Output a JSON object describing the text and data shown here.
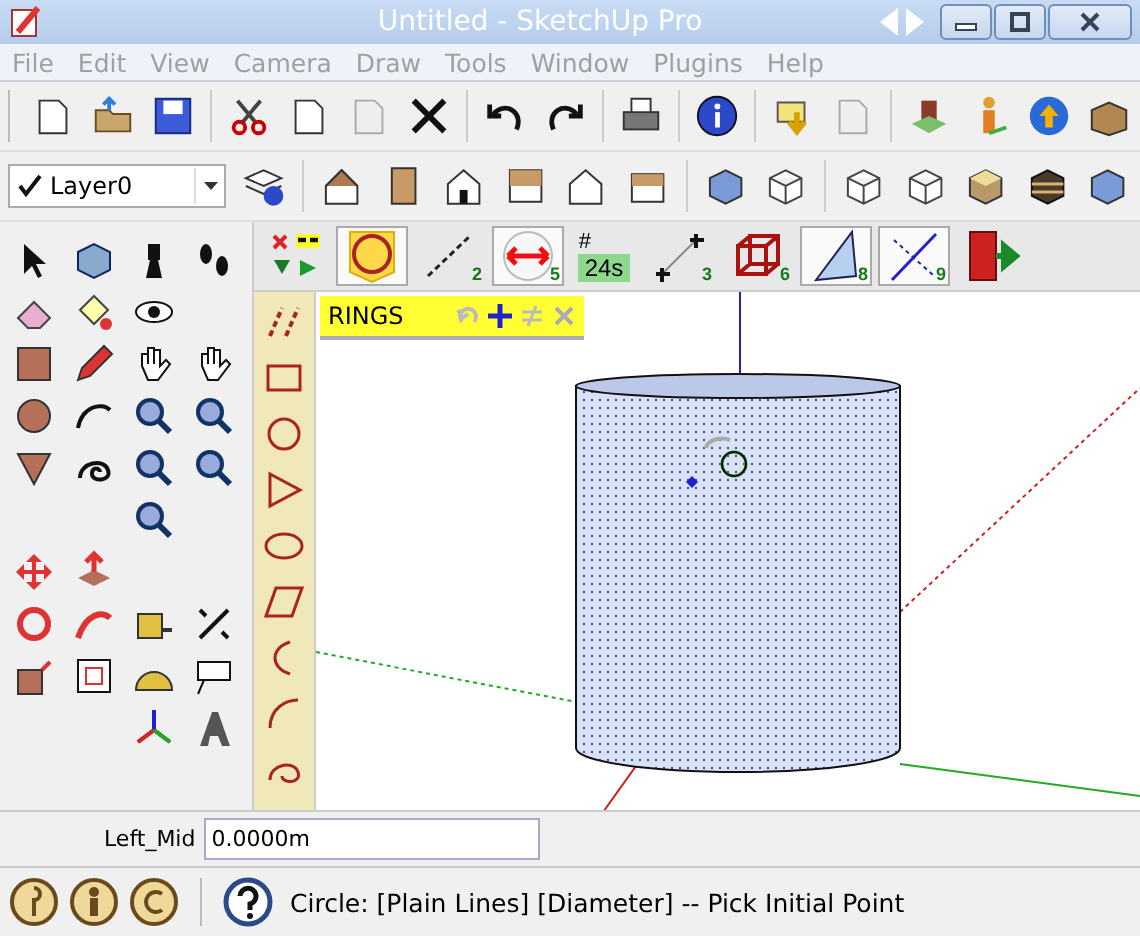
{
  "window": {
    "title": "Untitled - SketchUp Pro",
    "active": false
  },
  "menu": [
    {
      "label": "File"
    },
    {
      "label": "Edit"
    },
    {
      "label": "View"
    },
    {
      "label": "Camera"
    },
    {
      "label": "Draw"
    },
    {
      "label": "Tools"
    },
    {
      "label": "Window"
    },
    {
      "label": "Plugins"
    },
    {
      "label": "Help"
    }
  ],
  "layer": {
    "name": "Layer0"
  },
  "plugin_toolbar": [
    {
      "kind": "flags",
      "selected": false
    },
    {
      "kind": "circle",
      "selected": true
    },
    {
      "kind": "line",
      "badge": "2",
      "selected": false
    },
    {
      "kind": "diameter",
      "badge": "5",
      "selected": true
    },
    {
      "kind": "count",
      "symbol": "#",
      "value": "24s",
      "selected": false
    },
    {
      "kind": "points",
      "badge": "3",
      "selected": false
    },
    {
      "kind": "cube",
      "badge": "6",
      "selected": false
    },
    {
      "kind": "triangle",
      "badge": "8",
      "selected": true
    },
    {
      "kind": "slash",
      "badge": "9",
      "selected": true
    },
    {
      "kind": "exit",
      "selected": false
    }
  ],
  "rings_panel": {
    "title": "RINGS"
  },
  "vcb": {
    "label": "Left_Mid",
    "value": "0.0000m"
  },
  "status": {
    "text": "Circle: [Plain Lines]  [Diameter] -- Pick Initial Point"
  }
}
